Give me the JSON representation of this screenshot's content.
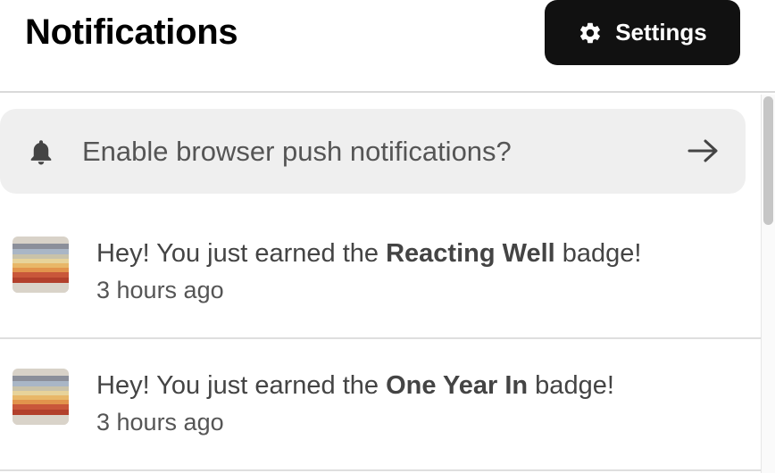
{
  "header": {
    "title": "Notifications",
    "settings_label": "Settings"
  },
  "push_banner": {
    "text": "Enable browser push notifications?",
    "icon": "bell-icon",
    "action_icon": "arrow-right-icon"
  },
  "notifications": [
    {
      "prefix": "Hey! You just earned the ",
      "badge": "Reacting Well",
      "suffix": " badge!",
      "time": "3 hours ago"
    },
    {
      "prefix": "Hey! You just earned the ",
      "badge": "One Year In",
      "suffix": " badge!",
      "time": "3 hours ago"
    }
  ],
  "colors": {
    "button_bg": "#111111",
    "banner_bg": "#efefef",
    "divider": "#dedede"
  }
}
